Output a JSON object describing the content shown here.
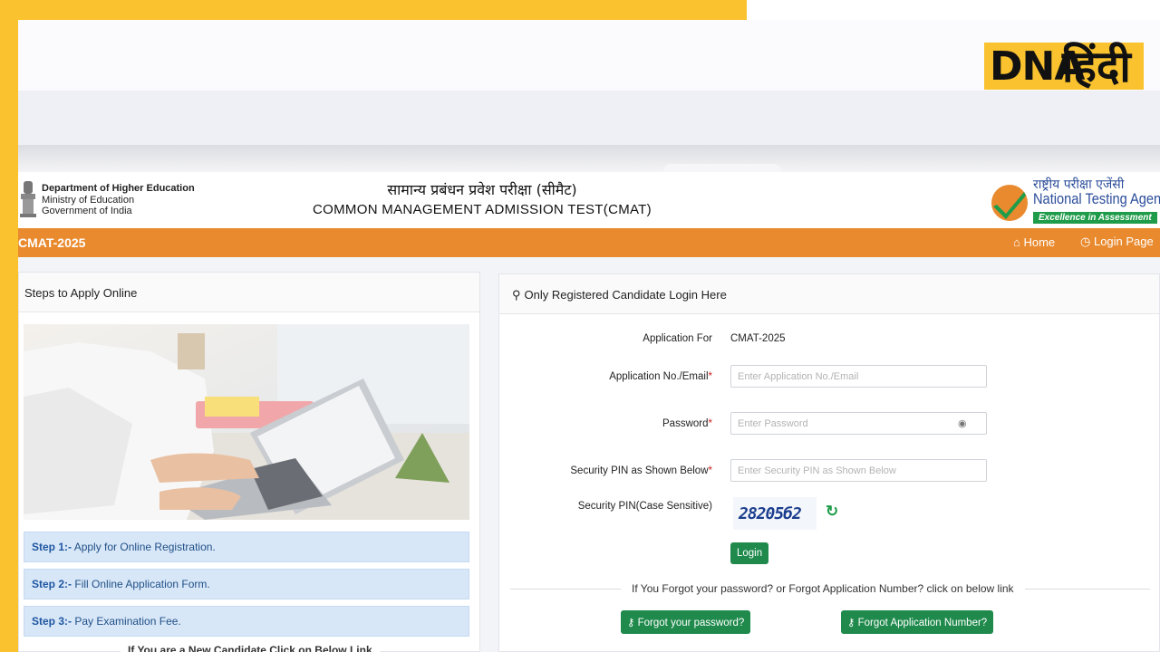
{
  "watermark": {
    "brand": "DNA",
    "brand_hindi": "हिंदी"
  },
  "header": {
    "dept_line1": "Department of Higher Education",
    "dept_line2": "Ministry of Education",
    "dept_line3": "Government of India",
    "title_hindi": "सामान्य प्रबंधन प्रवेश परीक्षा (सीमैट)",
    "title_english": "COMMON MANAGEMENT ADMISSION TEST(CMAT)",
    "agency_hindi": "राष्ट्रीय परीक्षा एजेंसी",
    "agency_english": "National Testing Agency",
    "agency_tagline": "Excellence in Assessment"
  },
  "navbar": {
    "title": "CMAT-2025",
    "home_label": "Home",
    "login_label": "Login Page"
  },
  "left_panel": {
    "heading": "Steps to Apply Online",
    "steps": [
      {
        "prefix": "Step 1:-",
        "text": "Apply for Online Registration."
      },
      {
        "prefix": "Step 2:-",
        "text": "Fill Online Application Form."
      },
      {
        "prefix": "Step 3:-",
        "text": "Pay Examination Fee."
      }
    ],
    "new_candidate_text": "If You are a New Candidate Click on Below Link"
  },
  "login_panel": {
    "heading": "Only Registered Candidate Login Here",
    "application_for_label": "Application For",
    "application_for_value": "CMAT-2025",
    "app_no_label": "Application No./Email",
    "app_no_placeholder": "Enter Application No./Email",
    "password_label": "Password",
    "password_placeholder": "Enter Password",
    "pin_label": "Security PIN as Shown Below",
    "pin_placeholder": "Enter Security PIN as Shown Below",
    "pin_case_label": "Security PIN(Case Sensitive)",
    "captcha_text": "28205б2",
    "login_button": "Login",
    "forgot_text": "If You Forgot your password? or Forgot Application Number? click on below link",
    "forgot_password_button": "Forgot your password?",
    "forgot_appno_button": "Forgot Application Number?",
    "required_mark": "*"
  },
  "colors": {
    "accent_orange": "#e98a2e",
    "button_green": "#1f8a4c",
    "overlay_yellow": "#f9c22e",
    "step_blue": "#d8e7f8"
  },
  "icons": {
    "home": "home-icon",
    "login": "clock-icon",
    "user": "user-icon",
    "eye": "eye-icon",
    "refresh": "refresh-icon",
    "key": "key-icon"
  }
}
